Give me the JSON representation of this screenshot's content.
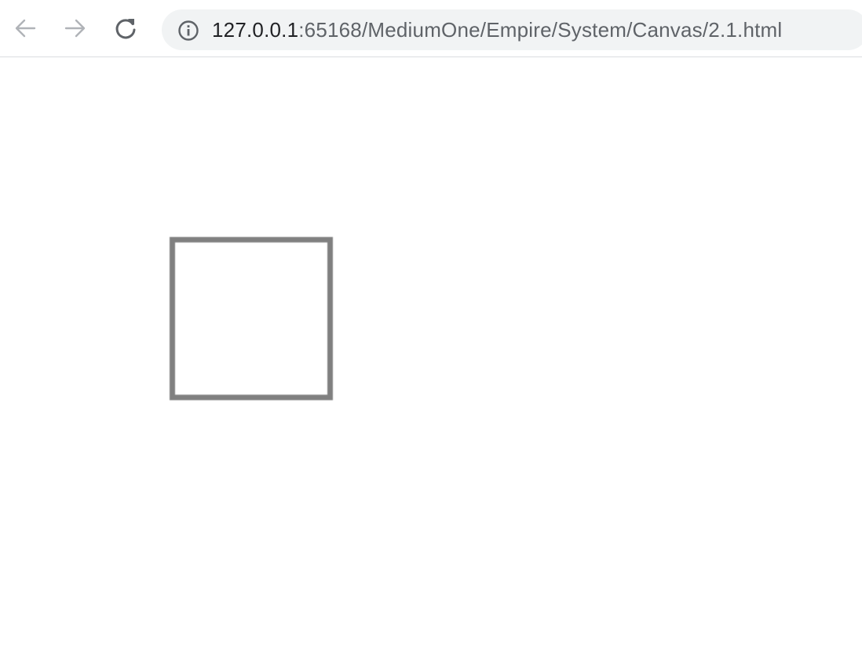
{
  "browser": {
    "url_host": "127.0.0.1",
    "url_path": ":65168/MediumOne/Empire/System/Canvas/2.1.html",
    "icons": {
      "back": "arrow-left-icon",
      "forward": "arrow-right-icon",
      "reload": "reload-icon",
      "site_info": "info-icon"
    },
    "colors": {
      "toolbar_bg": "#ffffff",
      "omnibox_bg": "#f1f3f4",
      "nav_disabled": "#b0b3b8",
      "nav_active": "#5f6368"
    }
  },
  "canvas": {
    "shape": "stroked-square",
    "stroke_color": "#808080",
    "fill": "none"
  }
}
